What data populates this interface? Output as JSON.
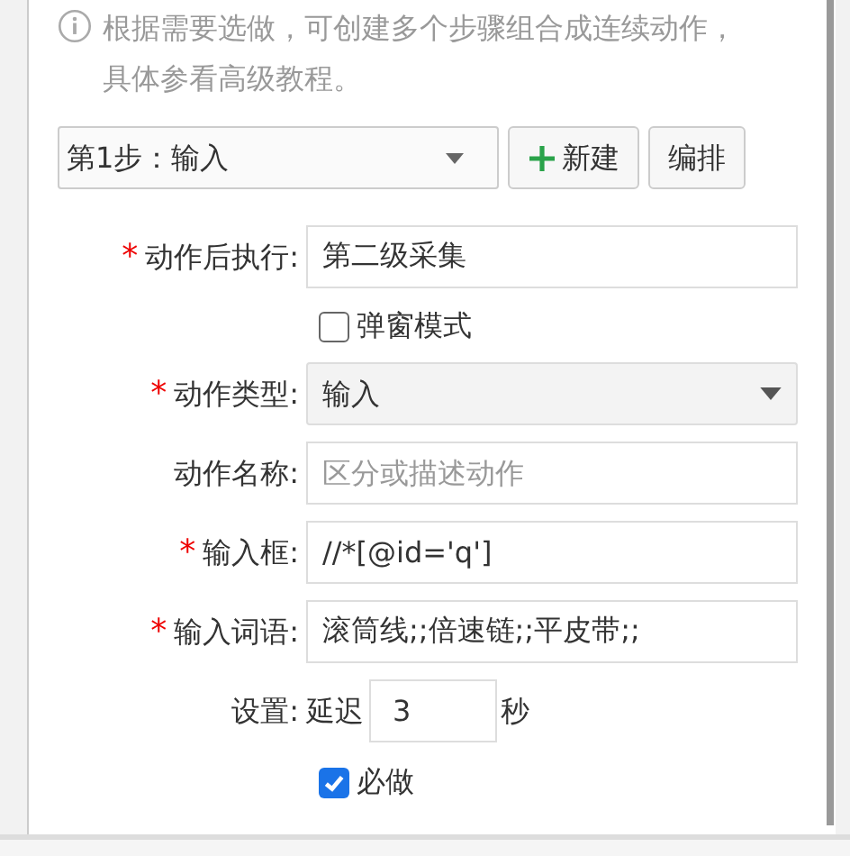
{
  "hint": "根据需要选做，可创建多个步骤组合成连续动作，具体参看高级教程。",
  "required_mark": "*",
  "step_select": {
    "value": "第1步：输入"
  },
  "buttons": [
    {
      "kind": "add",
      "label": "新建"
    },
    {
      "kind": "plain",
      "label": "编排"
    }
  ],
  "fields": [
    {
      "kind": "text",
      "label": "动作后执行:",
      "required": true,
      "value": "第二级采集"
    },
    {
      "kind": "check",
      "label": "弹窗模式",
      "checked": false
    },
    {
      "kind": "select",
      "label": "动作类型:",
      "required": true,
      "value": "输入"
    },
    {
      "kind": "text",
      "label": "动作名称:",
      "required": false,
      "placeholder": "区分或描述动作"
    },
    {
      "kind": "text",
      "label": "输入框:",
      "required": true,
      "value": "//*[@id='q']"
    },
    {
      "kind": "text",
      "label": "输入词语:",
      "required": true,
      "value": "滚筒线;;倍速链;;平皮带;;"
    },
    {
      "kind": "delay",
      "label": "设置:",
      "prefix": "延迟",
      "value": "3",
      "suffix": "秒"
    },
    {
      "kind": "check",
      "label": "必做",
      "checked": true
    }
  ]
}
